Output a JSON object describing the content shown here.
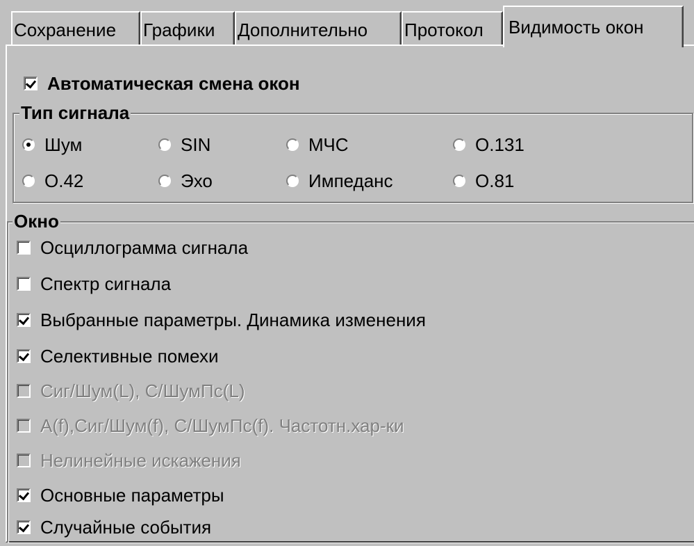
{
  "tabs": [
    {
      "label": "Сохранение",
      "active": false
    },
    {
      "label": "Графики",
      "active": false
    },
    {
      "label": "Дополнительно",
      "active": false
    },
    {
      "label": "Протокол",
      "active": false
    },
    {
      "label": "Видимость окон",
      "active": true
    }
  ],
  "auto_switch": {
    "label": "Автоматическая смена окон",
    "checked": true
  },
  "signal_type": {
    "title": "Тип сигнала",
    "options": [
      {
        "label": "Шум",
        "selected": true
      },
      {
        "label": "SIN",
        "selected": false
      },
      {
        "label": "МЧС",
        "selected": false
      },
      {
        "label": "О.131",
        "selected": false
      },
      {
        "label": "О.42",
        "selected": false
      },
      {
        "label": "Эхо",
        "selected": false
      },
      {
        "label": "Импеданс",
        "selected": false
      },
      {
        "label": "О.81",
        "selected": false
      }
    ]
  },
  "window": {
    "title": "Окно",
    "items": [
      {
        "label": "Осциллограмма сигнала",
        "checked": false,
        "enabled": true
      },
      {
        "label": "Спектр сигнала",
        "checked": false,
        "enabled": true
      },
      {
        "label": "Выбранные параметры. Динамика изменения",
        "checked": true,
        "enabled": true
      },
      {
        "label": "Селективные помехи",
        "checked": true,
        "enabled": true
      },
      {
        "label": "Сиг/Шум(L), С/ШумПс(L)",
        "checked": false,
        "enabled": false
      },
      {
        "label": "А(f),Сиг/Шум(f), С/ШумПс(f). Частотн.хар-ки",
        "checked": false,
        "enabled": false
      },
      {
        "label": "Нелинейные искажения",
        "checked": false,
        "enabled": false
      },
      {
        "label": "Основные параметры",
        "checked": true,
        "enabled": true
      },
      {
        "label": "Случайные события",
        "checked": true,
        "enabled": true
      }
    ]
  }
}
